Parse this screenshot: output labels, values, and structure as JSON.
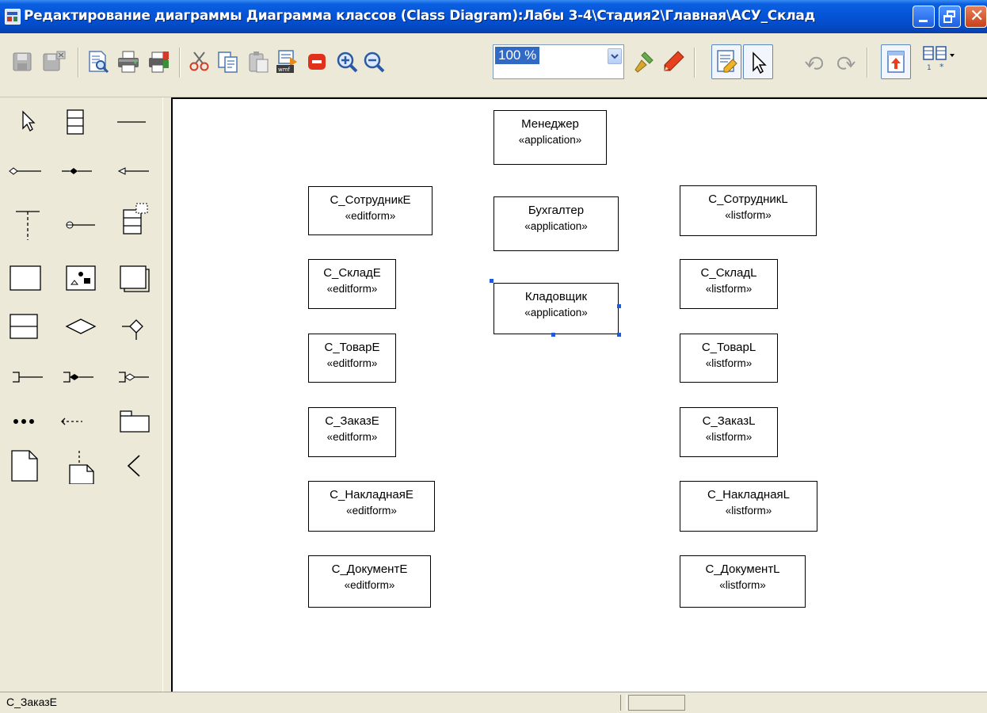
{
  "window": {
    "title": "Редактирование диаграммы Диаграмма классов (Class Diagram):Лабы 3-4\\Стадия2\\Главная\\АСУ_Склад",
    "title_bar_color": "#0453d6",
    "close_button_color": "#c8401b"
  },
  "toolbar": {
    "zoom": {
      "value": "100 %"
    },
    "buttons": [
      "save-icon",
      "save-all-icon",
      "print-preview-icon",
      "print-icon",
      "print-settings-icon",
      "cut-icon",
      "copy-icon",
      "paste-icon",
      "export-wmf-icon",
      "delete-icon",
      "zoom-in-icon",
      "zoom-out-icon",
      "format-brush-icon",
      "pencil-icon",
      "edit-properties-icon",
      "select-pointer-icon",
      "undo-icon",
      "redo-icon",
      "bring-to-front-icon",
      "multiplicity-icon"
    ]
  },
  "palette": {
    "tools": [
      "pointer-tool",
      "class-tool",
      "association-tool",
      "aggregation-tool",
      "composition-tool",
      "navigable-association-tool",
      "lifeline-tool",
      "interface-lollipop-tool",
      "template-class-tool",
      "note-box-tool",
      "image-tool",
      "package-tool",
      "split-box-tool",
      "decision-diamond-tool",
      "realization-tool",
      "bracket-link-tool",
      "bracket-composition-tool",
      "bracket-aggregation-tool",
      "ellipsis-tool",
      "dependency-tool",
      "folder-tool",
      "note-tool",
      "note-anchor-tool",
      "angle-tool"
    ]
  },
  "diagram": {
    "classes": [
      {
        "name": "Менеджер",
        "stereotype": "«application»"
      },
      {
        "name": "Бухгалтер",
        "stereotype": "«application»"
      },
      {
        "name": "Кладовщик",
        "stereotype": "«application»"
      },
      {
        "name": "С_СотрудникE",
        "stereotype": "«editform»"
      },
      {
        "name": "С_СкладE",
        "stereotype": "«editform»"
      },
      {
        "name": "С_ТоварE",
        "stereotype": "«editform»"
      },
      {
        "name": "С_ЗаказE",
        "stereotype": "«editform»"
      },
      {
        "name": "С_НакладнаяE",
        "stereotype": "«editform»"
      },
      {
        "name": "С_ДокументE",
        "stereotype": "«editform»"
      },
      {
        "name": "С_СотрудникL",
        "stereotype": "«listform»"
      },
      {
        "name": "С_СкладL",
        "stereotype": "«listform»"
      },
      {
        "name": "С_ТоварL",
        "stereotype": "«listform»"
      },
      {
        "name": "С_ЗаказL",
        "stereotype": "«listform»"
      },
      {
        "name": "С_НакладнаяL",
        "stereotype": "«listform»"
      },
      {
        "name": "С_ДокументL",
        "stereotype": "«listform»"
      }
    ],
    "selected": "Кладовщик",
    "selection_color": "#1e5bd6"
  },
  "status": {
    "text": "С_ЗаказE"
  }
}
